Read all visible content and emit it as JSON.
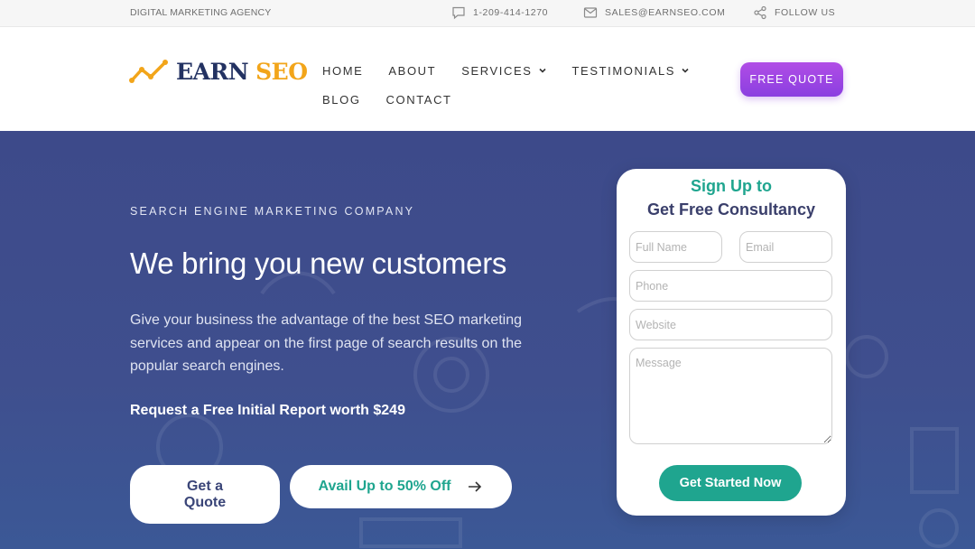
{
  "topbar": {
    "tagline": "DIGITAL MARKETING AGENCY",
    "phone": "1-209-414-1270",
    "email": "SALES@EARNSEO.COM",
    "follow": "FOLLOW US"
  },
  "logo": {
    "word1": "EARN",
    "word2": "SEO"
  },
  "nav": {
    "items": [
      {
        "label": "HOME"
      },
      {
        "label": "ABOUT"
      },
      {
        "label": "SERVICES"
      },
      {
        "label": "TESTIMONIALS"
      },
      {
        "label": "BLOG"
      },
      {
        "label": "CONTACT"
      }
    ]
  },
  "header": {
    "cta_label": "FREE QUOTE"
  },
  "hero": {
    "eyebrow": "SEARCH ENGINE MARKETING COMPANY",
    "headline": "We bring you new customers",
    "description": "Give your business the advantage of the best SEO marketing services and appear on the first page of search results on the popular search engines.",
    "offer": "Request a Free Initial Report worth $249",
    "quote_button": "Get a Quote",
    "avail_button": "Avail Up to 50% Off"
  },
  "form": {
    "title_line1": "Sign Up to",
    "title_line2": "Get Free Consultancy",
    "fullname_placeholder": "Full Name",
    "email_placeholder": "Email",
    "phone_placeholder": "Phone",
    "website_placeholder": "Website",
    "message_placeholder": "Message",
    "submit_label": "Get Started Now"
  },
  "colors": {
    "accent_purple": "#9b45e4",
    "accent_teal": "#1fa58f",
    "hero_bg": "#3d4a8a",
    "logo_navy": "#233262",
    "logo_orange": "#f2a51a"
  },
  "icons": {
    "phone": "chat-bubble-icon",
    "email": "envelope-icon",
    "follow": "share-icon",
    "dropdown": "chevron-down-icon",
    "avail": "arrow-right-icon"
  }
}
